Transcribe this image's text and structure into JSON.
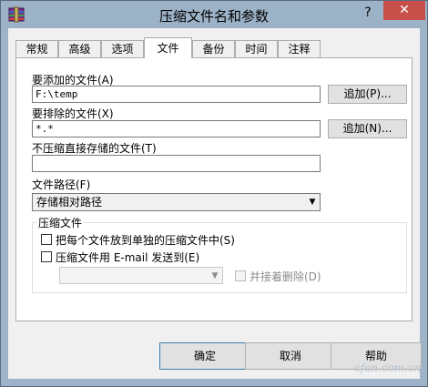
{
  "window": {
    "title": "压缩文件名和参数",
    "help_glyph": "?",
    "close_glyph": "✕"
  },
  "tabs": [
    {
      "label": "常规"
    },
    {
      "label": "高级"
    },
    {
      "label": "选项"
    },
    {
      "label": "文件"
    },
    {
      "label": "备份"
    },
    {
      "label": "时间"
    },
    {
      "label": "注释"
    }
  ],
  "active_tab": "文件",
  "files": {
    "add_label": "要添加的文件(A)",
    "add_value": "F:\\temp",
    "add_button": "追加(P)...",
    "exclude_label": "要排除的文件(X)",
    "exclude_value": "*.*",
    "exclude_button": "追加(N)...",
    "store_label": "不压缩直接存储的文件(T)",
    "store_value": "",
    "path_label": "文件路径(F)",
    "path_selected": "存储相对路径"
  },
  "compress_group": {
    "title": "压缩文件",
    "separate_archives": "把每个文件放到单独的压缩文件中(S)",
    "email": "压缩文件用 E-mail 发送到(E)",
    "email_value": "",
    "delete_after": "并接着删除(D)"
  },
  "buttons": {
    "ok": "确定",
    "cancel": "取消",
    "help": "帮助"
  },
  "watermark": "cfan.com.cn",
  "colors": {
    "titlebar": "#9cb2c7",
    "close": "#c7504a",
    "panel": "#ffffff",
    "dialog": "#f0f0f0"
  }
}
